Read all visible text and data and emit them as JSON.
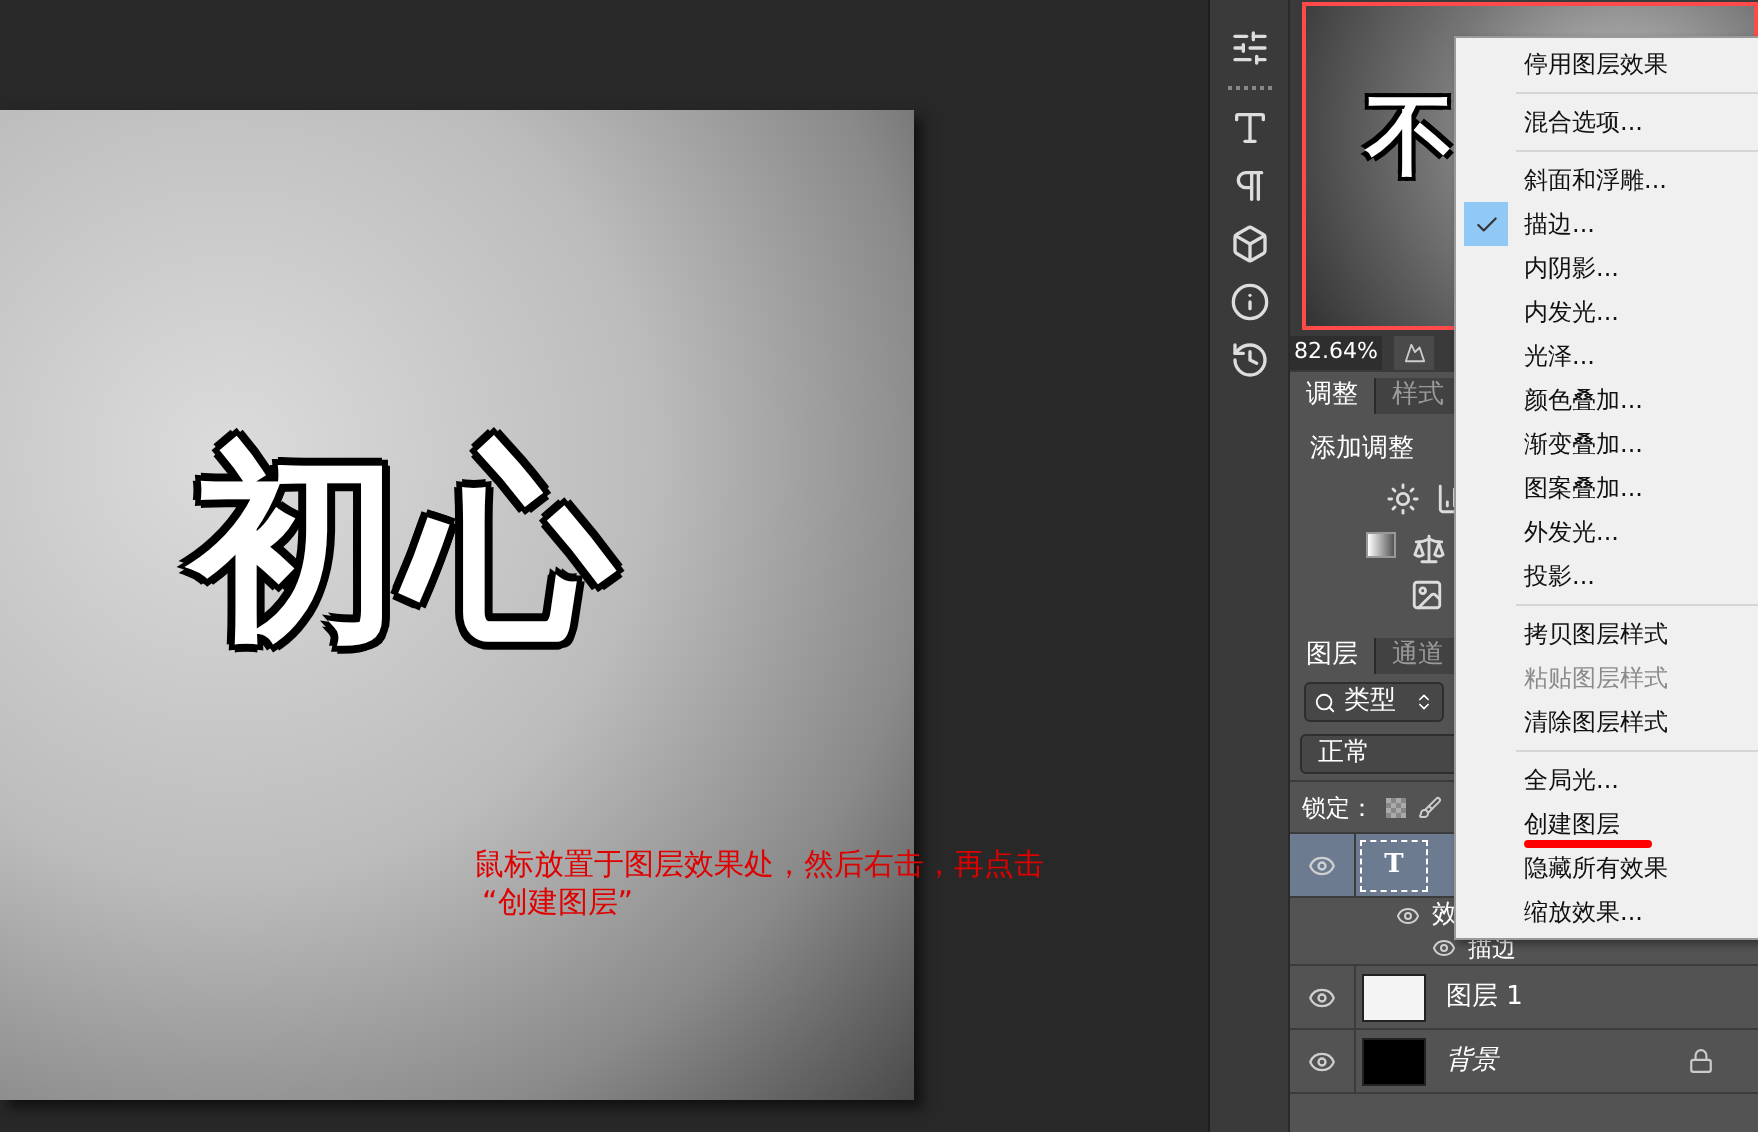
{
  "canvas": {
    "document_text": "初心",
    "thumbnail_text": "不",
    "annotation_lines": [
      "鼠标放置于图层效果处，然后右击，再点击",
      "“创建图层”"
    ]
  },
  "navigator": {
    "zoom": "82.64%"
  },
  "adjustments": {
    "tabs": [
      {
        "label": "调整",
        "selected": true
      },
      {
        "label": "样式",
        "selected": false
      }
    ],
    "heading": "添加调整"
  },
  "layers_panel": {
    "tabs": [
      {
        "label": "图层",
        "selected": true
      },
      {
        "label": "通道",
        "selected": false
      }
    ],
    "filter": "类型",
    "blend_mode": "正常",
    "lock_label": "锁定：",
    "layers": [
      {
        "kind": "text",
        "glyph": "T",
        "selected": true,
        "visible": true,
        "locked": false,
        "children": [
          {
            "name": "效",
            "visible": true,
            "children": [
              {
                "name": "描边",
                "visible": true
              }
            ]
          }
        ]
      },
      {
        "kind": "transparent",
        "name": "图层 1",
        "selected": false,
        "visible": true,
        "locked": false
      },
      {
        "kind": "fill",
        "name": "背景",
        "selected": false,
        "visible": true,
        "locked": true
      }
    ]
  },
  "context_menu": [
    {
      "kind": "item",
      "label": "停用图层效果",
      "checked": false,
      "disabled": false,
      "annotated": false
    },
    {
      "kind": "separator"
    },
    {
      "kind": "item",
      "label": "混合选项...",
      "checked": false,
      "disabled": false,
      "annotated": false
    },
    {
      "kind": "separator"
    },
    {
      "kind": "item",
      "label": "斜面和浮雕...",
      "checked": false,
      "disabled": false,
      "annotated": false
    },
    {
      "kind": "item",
      "label": "描边...",
      "checked": true,
      "disabled": false,
      "annotated": false
    },
    {
      "kind": "item",
      "label": "内阴影...",
      "checked": false,
      "disabled": false,
      "annotated": false
    },
    {
      "kind": "item",
      "label": "内发光...",
      "checked": false,
      "disabled": false,
      "annotated": false
    },
    {
      "kind": "item",
      "label": "光泽...",
      "checked": false,
      "disabled": false,
      "annotated": false
    },
    {
      "kind": "item",
      "label": "颜色叠加...",
      "checked": false,
      "disabled": false,
      "annotated": false
    },
    {
      "kind": "item",
      "label": "渐变叠加...",
      "checked": false,
      "disabled": false,
      "annotated": false
    },
    {
      "kind": "item",
      "label": "图案叠加...",
      "checked": false,
      "disabled": false,
      "annotated": false
    },
    {
      "kind": "item",
      "label": "外发光...",
      "checked": false,
      "disabled": false,
      "annotated": false
    },
    {
      "kind": "item",
      "label": "投影...",
      "checked": false,
      "disabled": false,
      "annotated": false
    },
    {
      "kind": "separator"
    },
    {
      "kind": "item",
      "label": "拷贝图层样式",
      "checked": false,
      "disabled": false,
      "annotated": false
    },
    {
      "kind": "item",
      "label": "粘贴图层样式",
      "checked": false,
      "disabled": true,
      "annotated": false
    },
    {
      "kind": "item",
      "label": "清除图层样式",
      "checked": false,
      "disabled": false,
      "annotated": false
    },
    {
      "kind": "separator"
    },
    {
      "kind": "item",
      "label": "全局光...",
      "checked": false,
      "disabled": false,
      "annotated": false
    },
    {
      "kind": "item",
      "label": "创建图层",
      "checked": false,
      "disabled": false,
      "annotated": true
    },
    {
      "kind": "item",
      "label": "隐藏所有效果",
      "checked": false,
      "disabled": false,
      "annotated": false
    },
    {
      "kind": "item",
      "label": "缩放效果...",
      "checked": false,
      "disabled": false,
      "annotated": false
    }
  ]
}
